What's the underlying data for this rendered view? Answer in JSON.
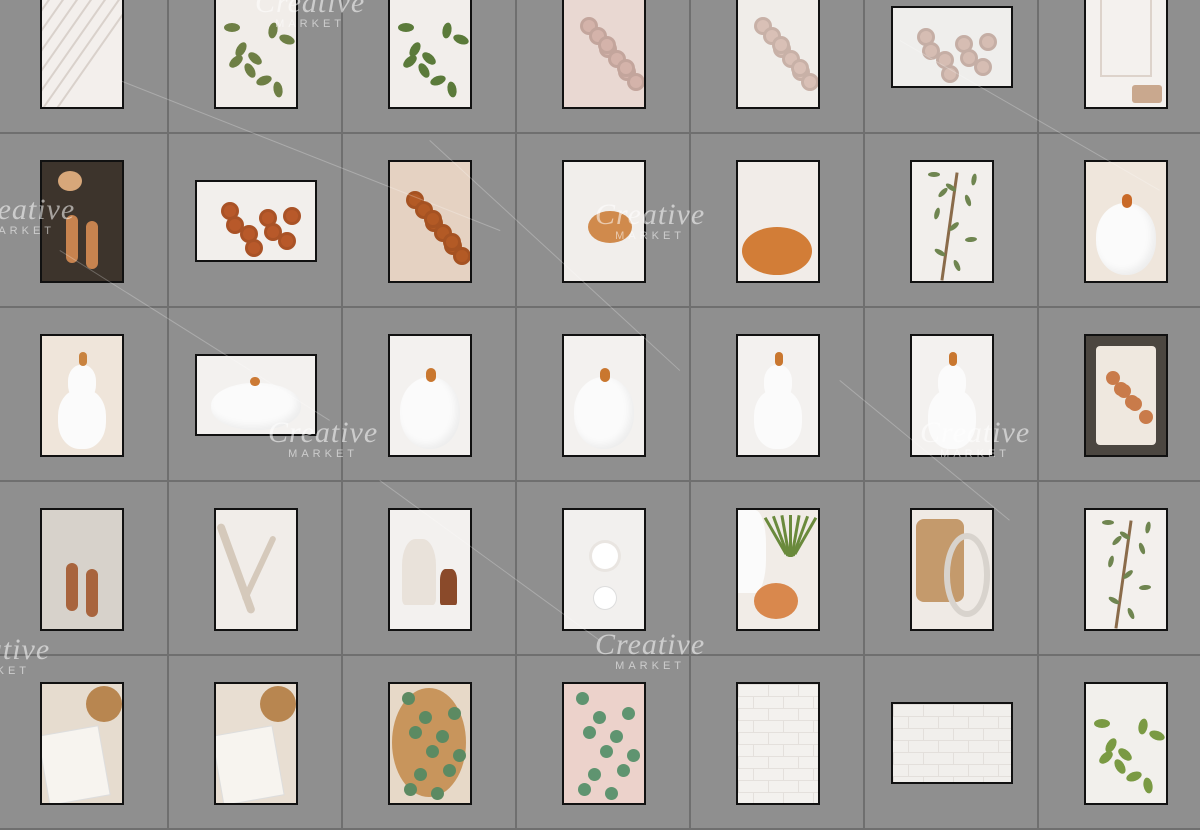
{
  "watermark": {
    "brand": "Creative",
    "sub": "MARKET"
  },
  "colors": {
    "background": "#8e8e8e",
    "cell_border": "#6f6f6f",
    "thumb_border": "#111111"
  },
  "grid": {
    "rows": [
      {
        "thumbs": [
          {
            "name": "white-paneled-wall-photo",
            "orientation": "portrait",
            "bg": "#f3efec",
            "accent": "#e6dfda",
            "motif": "stripes"
          },
          {
            "name": "greenery-branch-photo",
            "orientation": "portrait",
            "bg": "#f1ede9",
            "accent": "#6e7f45",
            "motif": "leaves"
          },
          {
            "name": "greenery-sprig-photo",
            "orientation": "portrait",
            "bg": "#f2eeeb",
            "accent": "#5b7a3a",
            "motif": "leaves"
          },
          {
            "name": "blush-roses-photo",
            "orientation": "portrait",
            "bg": "#e9d8d2",
            "accent": "#d4b3aa",
            "motif": "flowers"
          },
          {
            "name": "rose-bouquet-top-photo",
            "orientation": "portrait",
            "bg": "#f0ede9",
            "accent": "#d9c0b6",
            "motif": "flowers"
          },
          {
            "name": "rose-bouquet-landscape-photo",
            "orientation": "landscape",
            "bg": "#efeeec",
            "accent": "#d6bdb3",
            "motif": "flowers"
          },
          {
            "name": "white-doorway-photo",
            "orientation": "portrait",
            "bg": "#f4f1ee",
            "accent": "#c9a88e",
            "motif": "frame"
          }
        ]
      },
      {
        "thumbs": [
          {
            "name": "pumpkins-and-sandals-photo",
            "orientation": "portrait",
            "bg": "#3d342c",
            "accent": "#c7834f",
            "motif": "sandals"
          },
          {
            "name": "dried-bouquet-hand-photo",
            "orientation": "landscape",
            "bg": "#f2efec",
            "accent": "#b8592a",
            "motif": "flowers"
          },
          {
            "name": "dried-flowers-closeup-photo",
            "orientation": "portrait",
            "bg": "#e5d2c2",
            "accent": "#b35a25",
            "motif": "flowers"
          },
          {
            "name": "pumpkin-in-hand-photo",
            "orientation": "portrait",
            "bg": "#f1eeeb",
            "accent": "#d08a4c",
            "motif": "pumpkin"
          },
          {
            "name": "orange-pumpkin-photo",
            "orientation": "portrait",
            "bg": "#f1ece8",
            "accent": "#d27d37",
            "motif": "pumpkin-low"
          },
          {
            "name": "olive-branch-photo",
            "orientation": "portrait",
            "bg": "#f2efec",
            "accent": "#6f8550",
            "motif": "branch"
          },
          {
            "name": "white-pumpkin-orange-stem-photo",
            "orientation": "portrait",
            "bg": "#efe6dc",
            "accent": "#c96a28",
            "motif": "white-pumpkin"
          }
        ]
      },
      {
        "thumbs": [
          {
            "name": "white-gourd-photo",
            "orientation": "portrait",
            "bg": "#efe5da",
            "accent": "#c9833f",
            "motif": "gourd"
          },
          {
            "name": "white-pumpkin-landscape-photo",
            "orientation": "landscape",
            "bg": "#f3f1ef",
            "accent": "#cc7a35",
            "motif": "white-pumpkin"
          },
          {
            "name": "white-pumpkin-curly-stem-photo",
            "orientation": "portrait",
            "bg": "#f3f1ef",
            "accent": "#c9772f",
            "motif": "white-pumpkin"
          },
          {
            "name": "white-pumpkin-closeup-photo",
            "orientation": "portrait",
            "bg": "#f3f1ef",
            "accent": "#c9772f",
            "motif": "white-pumpkin"
          },
          {
            "name": "white-gourd-tall-photo",
            "orientation": "portrait",
            "bg": "#f3f1ef",
            "accent": "#c9772f",
            "motif": "gourd"
          },
          {
            "name": "white-gourd-tall-2-photo",
            "orientation": "portrait",
            "bg": "#f3f1ef",
            "accent": "#c9772f",
            "motif": "gourd"
          },
          {
            "name": "dried-flower-tray-photo",
            "orientation": "portrait",
            "bg": "#4b4640",
            "accent": "#c97b4a",
            "motif": "tray"
          }
        ]
      },
      {
        "thumbs": [
          {
            "name": "sandals-on-rug-photo",
            "orientation": "portrait",
            "bg": "#d7d2cb",
            "accent": "#a8643d",
            "motif": "sandals"
          },
          {
            "name": "driftwood-photo",
            "orientation": "portrait",
            "bg": "#f1ede9",
            "accent": "#d5c9bb",
            "motif": "driftwood"
          },
          {
            "name": "vases-photo",
            "orientation": "portrait",
            "bg": "#f3f1ef",
            "accent": "#8a4a2a",
            "motif": "vases"
          },
          {
            "name": "white-flower-vase-photo",
            "orientation": "portrait",
            "bg": "#f2f0ee",
            "accent": "#ffffff",
            "motif": "flower-vase"
          },
          {
            "name": "plant-and-pumpkin-photo",
            "orientation": "portrait",
            "bg": "#f1ece7",
            "accent": "#d9884d",
            "motif": "plant-pumpkin"
          },
          {
            "name": "wood-trinket-box-photo",
            "orientation": "portrait",
            "bg": "#efeae5",
            "accent": "#c49a6c",
            "motif": "box"
          },
          {
            "name": "olive-branch-2-photo",
            "orientation": "portrait",
            "bg": "#f3f0ed",
            "accent": "#6f8550",
            "motif": "branch"
          }
        ]
      },
      {
        "thumbs": [
          {
            "name": "book-and-wood-bowl-photo",
            "orientation": "portrait",
            "bg": "#e6dccf",
            "accent": "#b88650",
            "motif": "book"
          },
          {
            "name": "book-and-succulent-photo",
            "orientation": "portrait",
            "bg": "#e8ded2",
            "accent": "#b88650",
            "motif": "book"
          },
          {
            "name": "eucalyptus-bowl-photo",
            "orientation": "portrait",
            "bg": "#e7d9c8",
            "accent": "#5c8a62",
            "motif": "eucalyptus"
          },
          {
            "name": "eucalyptus-pink-photo",
            "orientation": "portrait",
            "bg": "#ecd2cb",
            "accent": "#5f9470",
            "motif": "eucalyptus"
          },
          {
            "name": "white-brick-wall-photo",
            "orientation": "portrait",
            "bg": "#f3f1ee",
            "accent": "#e4e0dc",
            "motif": "brick"
          },
          {
            "name": "white-brick-landscape-photo",
            "orientation": "landscape",
            "bg": "#f1efec",
            "accent": "#e3dfdb",
            "motif": "brick"
          },
          {
            "name": "brick-and-plant-photo",
            "orientation": "portrait",
            "bg": "#f2f0ec",
            "accent": "#7a9a43",
            "motif": "leaves"
          }
        ]
      }
    ]
  }
}
